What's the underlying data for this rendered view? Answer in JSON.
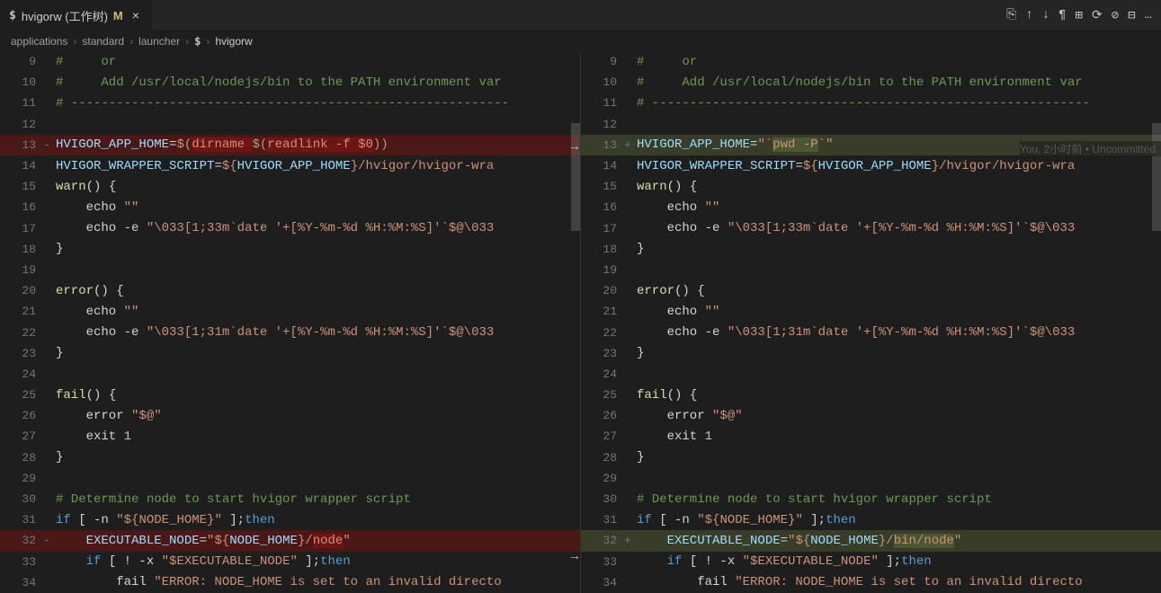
{
  "tab": {
    "prefix": "$",
    "label": "hvigorw (工作树)",
    "mod": "M",
    "close": "×"
  },
  "toolbar_icons": [
    "⎘",
    "↑",
    "↓",
    "¶",
    "⊞",
    "⟳",
    "⊘",
    "⊟",
    "…"
  ],
  "breadcrumb": [
    "applications",
    "standard",
    "launcher",
    "$",
    "hvigorw"
  ],
  "blame": "You, 2小时前 • Uncommitted",
  "left": [
    {
      "n": "9",
      "m": "",
      "t": "#     or",
      "cls": "c-comment"
    },
    {
      "n": "10",
      "m": "",
      "t": "#     Add /usr/local/nodejs/bin to the PATH environment var",
      "cls": "c-comment"
    },
    {
      "n": "11",
      "m": "",
      "t": "# ----------------------------------------------------------",
      "cls": "c-comment"
    },
    {
      "n": "12",
      "m": "",
      "t": "",
      "cls": ""
    },
    {
      "n": "13",
      "m": "-",
      "kind": "del",
      "segs": [
        {
          "t": "HVIGOR_APP_HOME",
          "c": "c-var"
        },
        {
          "t": "=",
          "c": ""
        },
        {
          "t": "$(",
          "c": "c-str"
        },
        {
          "t": "dirname ",
          "c": "c-str",
          "hl": true
        },
        {
          "t": "$(",
          "c": "c-str"
        },
        {
          "t": "readlink -f $0",
          "c": "c-str",
          "hl": true
        },
        {
          "t": "))",
          "c": "c-str"
        }
      ]
    },
    {
      "n": "14",
      "m": "",
      "segs": [
        {
          "t": "HVIGOR_WRAPPER_SCRIPT",
          "c": "c-var"
        },
        {
          "t": "=",
          "c": ""
        },
        {
          "t": "${",
          "c": "c-str"
        },
        {
          "t": "HVIGOR_APP_HOME",
          "c": "c-var"
        },
        {
          "t": "}",
          "c": "c-str"
        },
        {
          "t": "/hvigor/hvigor-wra",
          "c": "c-path"
        }
      ]
    },
    {
      "n": "15",
      "m": "",
      "segs": [
        {
          "t": "warn",
          "c": "c-func"
        },
        {
          "t": "() {",
          "c": ""
        }
      ]
    },
    {
      "n": "16",
      "m": "",
      "segs": [
        {
          "t": "    echo ",
          "c": ""
        },
        {
          "t": "\"\"",
          "c": "c-str"
        }
      ]
    },
    {
      "n": "17",
      "m": "",
      "segs": [
        {
          "t": "    echo -e ",
          "c": ""
        },
        {
          "t": "\"\\033[1;33m`date '+[%Y-%m-%d %H:%M:%S]'`$@\\033",
          "c": "c-str"
        }
      ]
    },
    {
      "n": "18",
      "m": "",
      "t": "}",
      "cls": ""
    },
    {
      "n": "19",
      "m": "",
      "t": "",
      "cls": ""
    },
    {
      "n": "20",
      "m": "",
      "segs": [
        {
          "t": "error",
          "c": "c-func"
        },
        {
          "t": "() {",
          "c": ""
        }
      ]
    },
    {
      "n": "21",
      "m": "",
      "segs": [
        {
          "t": "    echo ",
          "c": ""
        },
        {
          "t": "\"\"",
          "c": "c-str"
        }
      ]
    },
    {
      "n": "22",
      "m": "",
      "segs": [
        {
          "t": "    echo -e ",
          "c": ""
        },
        {
          "t": "\"\\033[1;31m`date '+[%Y-%m-%d %H:%M:%S]'`$@\\033",
          "c": "c-str"
        }
      ]
    },
    {
      "n": "23",
      "m": "",
      "t": "}",
      "cls": ""
    },
    {
      "n": "24",
      "m": "",
      "t": "",
      "cls": ""
    },
    {
      "n": "25",
      "m": "",
      "segs": [
        {
          "t": "fail",
          "c": "c-func"
        },
        {
          "t": "() {",
          "c": ""
        }
      ]
    },
    {
      "n": "26",
      "m": "",
      "segs": [
        {
          "t": "    error ",
          "c": ""
        },
        {
          "t": "\"$@\"",
          "c": "c-str"
        }
      ]
    },
    {
      "n": "27",
      "m": "",
      "segs": [
        {
          "t": "    exit ",
          "c": ""
        },
        {
          "t": "1",
          "c": "c-num"
        }
      ]
    },
    {
      "n": "28",
      "m": "",
      "t": "}",
      "cls": ""
    },
    {
      "n": "29",
      "m": "",
      "t": "",
      "cls": ""
    },
    {
      "n": "30",
      "m": "",
      "t": "# Determine node to start hvigor wrapper script",
      "cls": "c-comment"
    },
    {
      "n": "31",
      "m": "",
      "segs": [
        {
          "t": "if",
          "c": "c-keyw"
        },
        {
          "t": " [ -n ",
          "c": ""
        },
        {
          "t": "\"${NODE_HOME}\"",
          "c": "c-str"
        },
        {
          "t": " ];",
          "c": ""
        },
        {
          "t": "then",
          "c": "c-keyw"
        }
      ]
    },
    {
      "n": "32",
      "m": "-",
      "kind": "del",
      "segs": [
        {
          "t": "    EXECUTABLE_NODE",
          "c": "c-var"
        },
        {
          "t": "=",
          "c": ""
        },
        {
          "t": "\"${",
          "c": "c-str"
        },
        {
          "t": "NODE_HOME",
          "c": "c-var"
        },
        {
          "t": "}",
          "c": "c-str"
        },
        {
          "t": "/",
          "c": "c-str"
        },
        {
          "t": "node",
          "c": "c-str",
          "hl": true
        },
        {
          "t": "\"",
          "c": "c-str"
        }
      ]
    },
    {
      "n": "33",
      "m": "",
      "segs": [
        {
          "t": "    if",
          "c": "c-keyw"
        },
        {
          "t": " [ ! -x ",
          "c": ""
        },
        {
          "t": "\"$EXECUTABLE_NODE\"",
          "c": "c-str"
        },
        {
          "t": " ];",
          "c": ""
        },
        {
          "t": "then",
          "c": "c-keyw"
        }
      ]
    },
    {
      "n": "34",
      "m": "",
      "segs": [
        {
          "t": "        fail ",
          "c": ""
        },
        {
          "t": "\"ERROR: NODE_HOME is set to an invalid directo",
          "c": "c-str"
        }
      ]
    }
  ],
  "right": [
    {
      "n": "9",
      "m": "",
      "t": "#     or",
      "cls": "c-comment"
    },
    {
      "n": "10",
      "m": "",
      "t": "#     Add /usr/local/nodejs/bin to the PATH environment var",
      "cls": "c-comment"
    },
    {
      "n": "11",
      "m": "",
      "t": "# ----------------------------------------------------------",
      "cls": "c-comment"
    },
    {
      "n": "12",
      "m": "",
      "t": "",
      "cls": ""
    },
    {
      "n": "13",
      "m": "+",
      "kind": "add",
      "blame": true,
      "segs": [
        {
          "t": "HVIGOR_APP_HOME",
          "c": "c-var"
        },
        {
          "t": "=",
          "c": ""
        },
        {
          "t": "\"`",
          "c": "c-str"
        },
        {
          "t": "pwd -P",
          "c": "c-str",
          "hl": true
        },
        {
          "t": "`\"",
          "c": "c-str"
        }
      ]
    },
    {
      "n": "14",
      "m": "",
      "segs": [
        {
          "t": "HVIGOR_WRAPPER_SCRIPT",
          "c": "c-var"
        },
        {
          "t": "=",
          "c": ""
        },
        {
          "t": "${",
          "c": "c-str"
        },
        {
          "t": "HVIGOR_APP_HOME",
          "c": "c-var"
        },
        {
          "t": "}",
          "c": "c-str"
        },
        {
          "t": "/hvigor/hvigor-wra",
          "c": "c-path"
        }
      ]
    },
    {
      "n": "15",
      "m": "",
      "segs": [
        {
          "t": "warn",
          "c": "c-func"
        },
        {
          "t": "() {",
          "c": ""
        }
      ]
    },
    {
      "n": "16",
      "m": "",
      "segs": [
        {
          "t": "    echo ",
          "c": ""
        },
        {
          "t": "\"\"",
          "c": "c-str"
        }
      ]
    },
    {
      "n": "17",
      "m": "",
      "segs": [
        {
          "t": "    echo -e ",
          "c": ""
        },
        {
          "t": "\"\\033[1;33m`date '+[%Y-%m-%d %H:%M:%S]'`$@\\033",
          "c": "c-str"
        }
      ]
    },
    {
      "n": "18",
      "m": "",
      "t": "}",
      "cls": ""
    },
    {
      "n": "19",
      "m": "",
      "t": "",
      "cls": ""
    },
    {
      "n": "20",
      "m": "",
      "segs": [
        {
          "t": "error",
          "c": "c-func"
        },
        {
          "t": "() {",
          "c": ""
        }
      ]
    },
    {
      "n": "21",
      "m": "",
      "segs": [
        {
          "t": "    echo ",
          "c": ""
        },
        {
          "t": "\"\"",
          "c": "c-str"
        }
      ]
    },
    {
      "n": "22",
      "m": "",
      "segs": [
        {
          "t": "    echo -e ",
          "c": ""
        },
        {
          "t": "\"\\033[1;31m`date '+[%Y-%m-%d %H:%M:%S]'`$@\\033",
          "c": "c-str"
        }
      ]
    },
    {
      "n": "23",
      "m": "",
      "t": "}",
      "cls": ""
    },
    {
      "n": "24",
      "m": "",
      "t": "",
      "cls": ""
    },
    {
      "n": "25",
      "m": "",
      "segs": [
        {
          "t": "fail",
          "c": "c-func"
        },
        {
          "t": "() {",
          "c": ""
        }
      ]
    },
    {
      "n": "26",
      "m": "",
      "segs": [
        {
          "t": "    error ",
          "c": ""
        },
        {
          "t": "\"$@\"",
          "c": "c-str"
        }
      ]
    },
    {
      "n": "27",
      "m": "",
      "segs": [
        {
          "t": "    exit ",
          "c": ""
        },
        {
          "t": "1",
          "c": "c-num"
        }
      ]
    },
    {
      "n": "28",
      "m": "",
      "t": "}",
      "cls": ""
    },
    {
      "n": "29",
      "m": "",
      "t": "",
      "cls": ""
    },
    {
      "n": "30",
      "m": "",
      "t": "# Determine node to start hvigor wrapper script",
      "cls": "c-comment"
    },
    {
      "n": "31",
      "m": "",
      "segs": [
        {
          "t": "if",
          "c": "c-keyw"
        },
        {
          "t": " [ -n ",
          "c": ""
        },
        {
          "t": "\"${NODE_HOME}\"",
          "c": "c-str"
        },
        {
          "t": " ];",
          "c": ""
        },
        {
          "t": "then",
          "c": "c-keyw"
        }
      ]
    },
    {
      "n": "32",
      "m": "+",
      "kind": "add",
      "segs": [
        {
          "t": "    EXECUTABLE_NODE",
          "c": "c-var"
        },
        {
          "t": "=",
          "c": ""
        },
        {
          "t": "\"${",
          "c": "c-str"
        },
        {
          "t": "NODE_HOME",
          "c": "c-var"
        },
        {
          "t": "}",
          "c": "c-str"
        },
        {
          "t": "/",
          "c": "c-str"
        },
        {
          "t": "bin/node",
          "c": "c-str",
          "hl": true
        },
        {
          "t": "\"",
          "c": "c-str"
        }
      ]
    },
    {
      "n": "33",
      "m": "",
      "segs": [
        {
          "t": "    if",
          "c": "c-keyw"
        },
        {
          "t": " [ ! -x ",
          "c": ""
        },
        {
          "t": "\"$EXECUTABLE_NODE\"",
          "c": "c-str"
        },
        {
          "t": " ];",
          "c": ""
        },
        {
          "t": "then",
          "c": "c-keyw"
        }
      ]
    },
    {
      "n": "34",
      "m": "",
      "segs": [
        {
          "t": "        fail ",
          "c": ""
        },
        {
          "t": "\"ERROR: NODE_HOME is set to an invalid directo",
          "c": "c-str"
        }
      ]
    }
  ]
}
